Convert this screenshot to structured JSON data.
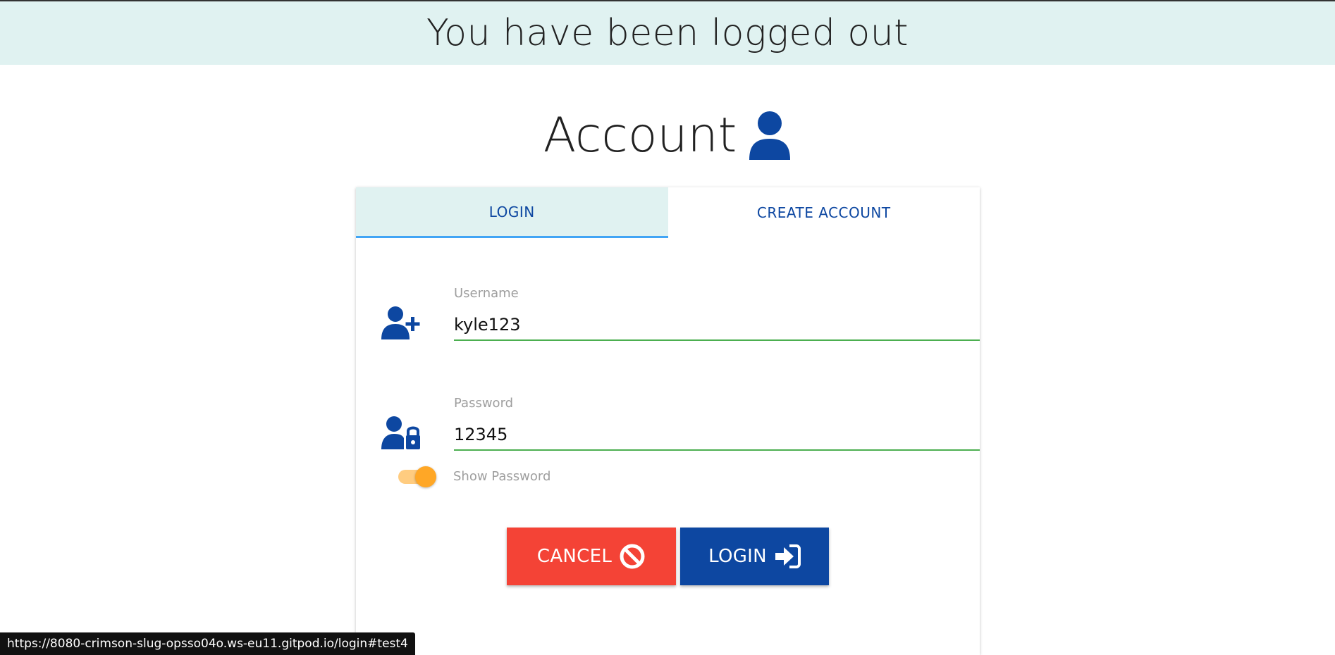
{
  "banner": {
    "message": "You have been logged out"
  },
  "header": {
    "title": "Account",
    "icon": "user-icon"
  },
  "tabs": [
    {
      "label": "LOGIN",
      "active": true
    },
    {
      "label": "CREATE ACCOUNT",
      "active": false
    }
  ],
  "form": {
    "username": {
      "label": "Username",
      "value": "kyle123",
      "icon": "user-plus-icon"
    },
    "password": {
      "label": "Password",
      "value": "12345",
      "icon": "user-lock-icon"
    },
    "show_password": {
      "label": "Show Password",
      "checked": true
    }
  },
  "buttons": {
    "cancel_label": "CANCEL",
    "cancel_icon": "ban-icon",
    "login_label": "LOGIN",
    "login_icon": "sign-in-icon"
  },
  "status_bar": {
    "url": "https://8080-crimson-slug-opsso04o.ws-eu11.gitpod.io/login#test4"
  },
  "colors": {
    "primary": "#0d47a1",
    "danger": "#f44336",
    "accent_orange": "#ffa726",
    "banner_bg": "#e0f2f1",
    "input_underline": "#4caf50",
    "tab_indicator": "#42a5f5"
  }
}
